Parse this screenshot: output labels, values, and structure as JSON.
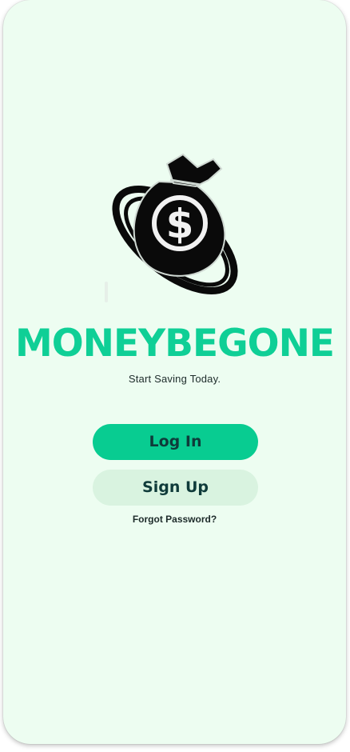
{
  "app": {
    "brand_name": "MONEYBEGONE",
    "tagline": "Start Saving Today.",
    "logo_icon": "money-bag-dollar-icon"
  },
  "actions": {
    "login_label": "Log In",
    "signup_label": "Sign Up",
    "forgot_label": "Forgot Password?"
  },
  "colors": {
    "background": "#edfdf1",
    "brand": "#0fcf96",
    "primary_button": "#08cc91",
    "secondary_button": "#d9f3e0",
    "text_dark": "#0f3b3a"
  }
}
